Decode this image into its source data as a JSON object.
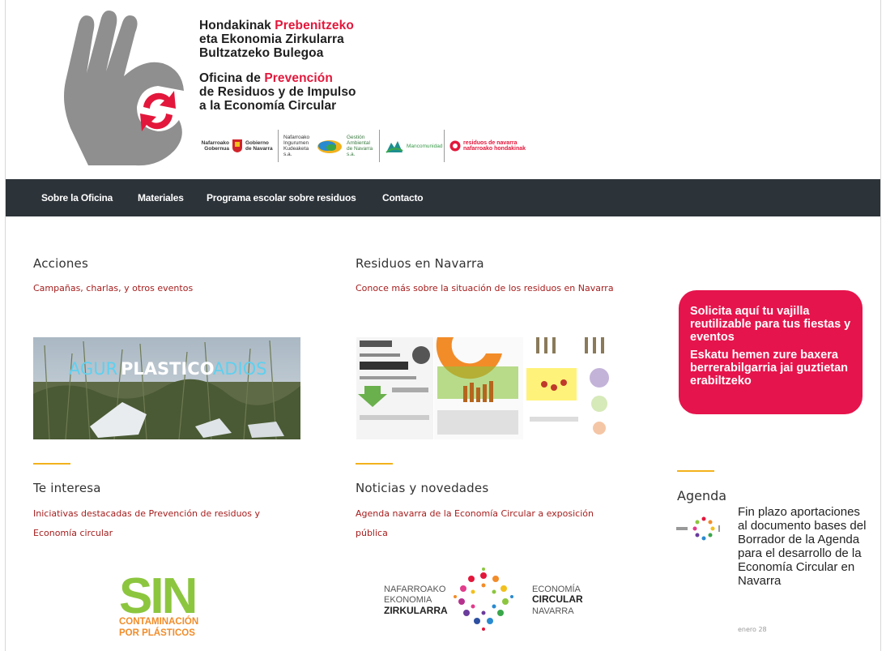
{
  "header": {
    "title_lines_eu": [
      {
        "a": "Hondakinak ",
        "b": "Prebenitzeko"
      },
      {
        "a": "eta Ekonomia Zirkularra",
        "b": ""
      },
      {
        "a": "Bultzatzeko Bulegoa",
        "b": ""
      }
    ],
    "title_lines_es": [
      {
        "a": "Oficina de ",
        "b": "Prevención"
      },
      {
        "a": "de Residuos y de Impulso",
        "b": ""
      },
      {
        "a": "a la Economía Circular",
        "b": ""
      }
    ],
    "sponsors": {
      "gov_left": "Nafarroako Gobernua",
      "gov_right": "Gobierno de Navarra",
      "nilsa": "Nafarroako Ingurumen Kudeaketa s.a.",
      "gan": "Gestión Ambiental de Navarra s.a.",
      "mancomunidad": "Mancomunidad",
      "residuos_line1": "residuos de navarra",
      "residuos_line2": "nafarroako hondakinak"
    }
  },
  "nav": {
    "items": [
      "Sobre la Oficina",
      "Materiales",
      "Programa escolar sobre residuos",
      "Contacto"
    ]
  },
  "sections": {
    "acciones": {
      "title": "Acciones",
      "link": "Campañas, charlas, y otros eventos",
      "banner_text_1": "AGUR",
      "banner_text_2": "PLASTICO",
      "banner_text_3": "ADIOS"
    },
    "residuos": {
      "title": "Residuos en Navarra",
      "link": "Conoce más sobre la situación de los residuos en Navarra"
    },
    "interesa": {
      "title": "Te interesa",
      "link": "Iniciativas destacadas de Prevención de residuos y Economía circular",
      "logo_big": "SIN",
      "logo_sub1": "CONTAMINACIÓN",
      "logo_sub2": "POR PLÁSTICOS"
    },
    "noticias": {
      "title": "Noticias y novedades",
      "link": "Agenda navarra  de la Economía Circular a exposición pública",
      "logo_left1": "NAFARROAKO",
      "logo_left2": "EKONOMIA",
      "logo_left3": "ZIRKULARRA",
      "logo_right1": "ECONOMÍA",
      "logo_right2": "CIRCULAR",
      "logo_right3": "NAVARRA"
    }
  },
  "promo": {
    "es": "Solicita aquí tu vajilla reutilizable para tus fiestas y eventos",
    "eu": "Eskatu hemen zure baxera berrerabilgarria jai guztietan erabiltzeko"
  },
  "agenda": {
    "title": "Agenda",
    "event_title": "Fin plazo aportaciones al documento bases del Borrador de la Agenda para el desarrollo de la Economía Circular en Navarra",
    "event_date": "enero 28"
  },
  "colors": {
    "nav_bg": "#2c3339",
    "accent_red": "#e3173b",
    "link_red": "#a61d1d",
    "bar_yellow": "#f2b21c",
    "promo_pink": "#e6144c"
  }
}
